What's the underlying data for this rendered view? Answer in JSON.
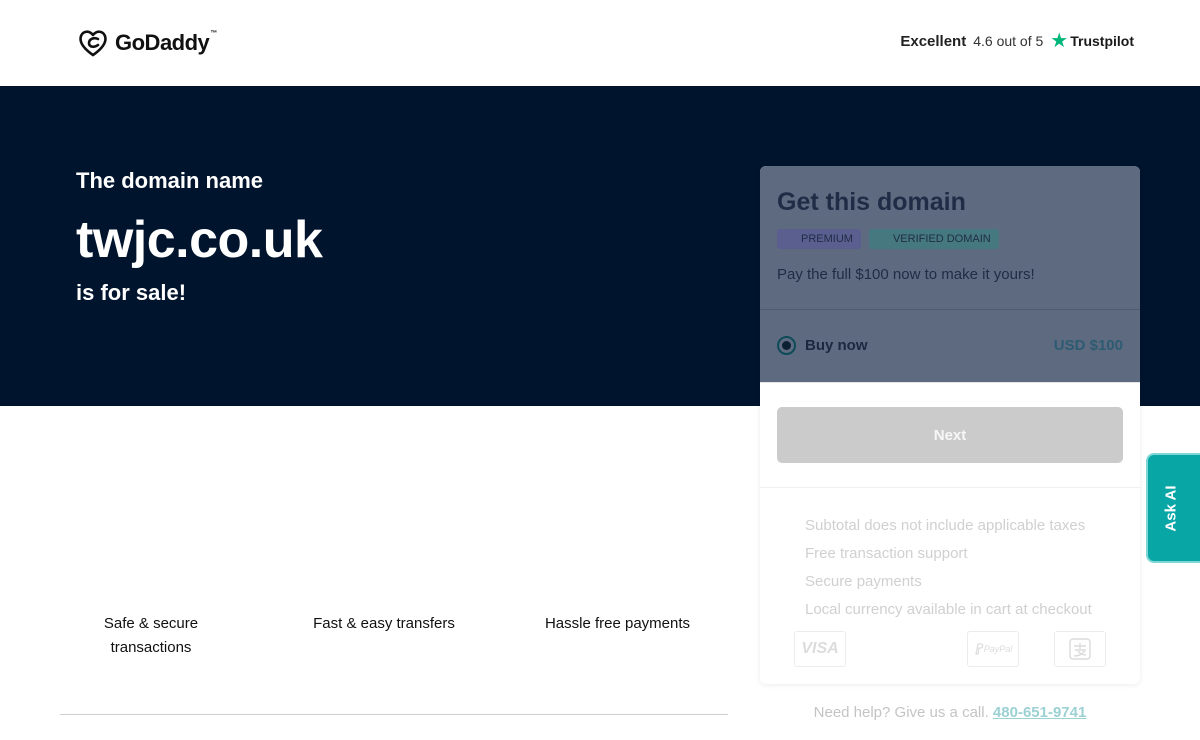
{
  "header": {
    "logo_text": "GoDaddy",
    "rating_word": "Excellent",
    "rating_score": "4.6 out of 5",
    "rating_brand": "Trustpilot"
  },
  "hero": {
    "pre": "The domain name",
    "domain": "twjc.co.uk",
    "post": "is for sale!"
  },
  "card": {
    "title": "Get this domain",
    "badges": [
      "PREMIUM",
      "VERIFIED DOMAIN"
    ],
    "description": "Pay the full $100 now to make it yours!",
    "option_label": "Buy now",
    "option_price": "USD $100",
    "next_label": "Next",
    "features": [
      "Subtotal does not include applicable taxes",
      "Free transaction support",
      "Secure payments",
      "Local currency available in cart at checkout"
    ],
    "payment_icons": [
      "visa-icon",
      "paypal-icon",
      "alipay-icon"
    ],
    "payment_labels": {
      "visa": "VISA",
      "paypal": "PayPal"
    }
  },
  "perks": [
    "Safe & secure transactions",
    "Fast & easy transfers",
    "Hassle free payments"
  ],
  "help": {
    "text": "Need help? Give us a call.",
    "phone": "480-651-9741"
  },
  "ask_ai": {
    "label": "Ask AI"
  },
  "colors": {
    "hero_bg": "#00142d",
    "accent_teal": "#09a6a6",
    "trustpilot_green": "#00b67a"
  }
}
